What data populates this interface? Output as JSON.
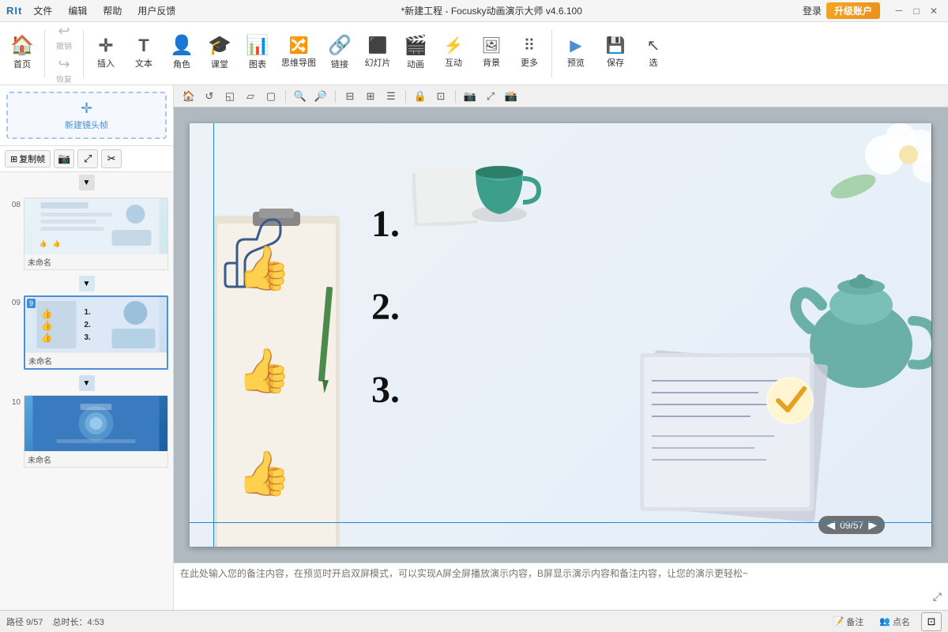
{
  "titlebar": {
    "logo": "RIt",
    "title": "*新建工程 - Focusky动画演示大师 v4.6.100",
    "login_label": "登录",
    "upgrade_label": "升级账户",
    "minimize": "－",
    "maximize": "□",
    "close": "✕"
  },
  "menubar": {
    "items": [
      "文件",
      "编辑",
      "帮助",
      "用户反馈"
    ]
  },
  "toolbar": {
    "home_icon": "🏠",
    "home_label": "首页",
    "undo_icon": "↩",
    "undo_label": "撤销",
    "redo_icon": "↪",
    "redo_label": "恢复",
    "insert_icon": "✛",
    "insert_label": "插入",
    "text_icon": "T",
    "text_label": "文本",
    "role_icon": "👤",
    "role_label": "角色",
    "class_icon": "🎓",
    "class_label": "课堂",
    "chart_icon": "📊",
    "chart_label": "图表",
    "mindmap_icon": "🧠",
    "mindmap_label": "思维导图",
    "link_icon": "🔗",
    "link_label": "链接",
    "slide_icon": "🎞",
    "slide_label": "幻灯片",
    "anim_icon": "🎬",
    "anim_label": "动画",
    "interact_icon": "🤝",
    "interact_label": "互动",
    "bg_icon": "🖼",
    "bg_label": "背景",
    "more_icon": "⋯",
    "more_label": "更多",
    "preview_icon": "▶",
    "preview_label": "预览",
    "save_icon": "💾",
    "save_label": "保存",
    "select_icon": "↗",
    "select_label": "选"
  },
  "sidebar": {
    "new_frame_label": "新建镜头帧",
    "copy_btn": "复制帧",
    "slides": [
      {
        "number": "08",
        "title": "未命名",
        "active": false,
        "bg": "light-blue",
        "frame_badge": ""
      },
      {
        "number": "09",
        "title": "未命名",
        "active": true,
        "bg": "blue",
        "frame_badge": "9"
      },
      {
        "number": "10",
        "title": "未命名",
        "active": false,
        "bg": "deep-blue",
        "frame_badge": ""
      }
    ]
  },
  "canvas": {
    "numbered_items": [
      "1.",
      "2.",
      "3."
    ],
    "page_counter": "09/57"
  },
  "notes": {
    "placeholder": "在此处输入您的备注内容，在预览时开启双屏模式，可以实现A屏全屏播放演示内容，B屏显示演示内容和备注内容，让您的演示更轻松~"
  },
  "statusbar": {
    "path_label": "路径 9/57",
    "duration_label": "总时长：4:53",
    "notes_label": "备注",
    "rollcall_label": "点名"
  },
  "canvas_tools": {
    "buttons": [
      "🏠",
      "↺",
      "◱",
      "▱",
      "▢",
      "🔍+",
      "🔍-",
      "⊟",
      "⊞",
      "≡",
      "🔒",
      "🗗",
      "⤢"
    ]
  }
}
